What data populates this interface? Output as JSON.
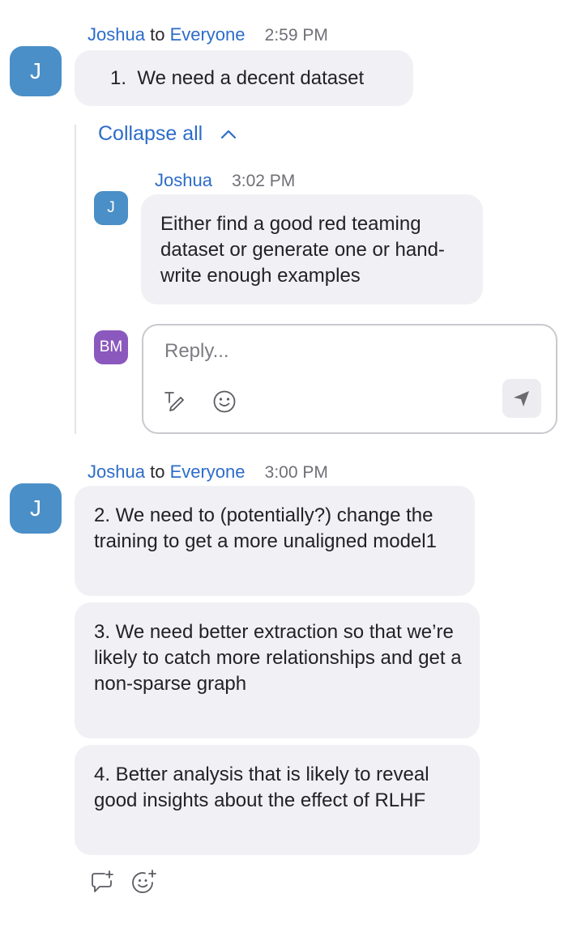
{
  "messages": [
    {
      "sender": "Joshua",
      "to_word": "to",
      "recipient": "Everyone",
      "time": "2:59 PM",
      "avatar": "J",
      "bubbles": [
        "1.  We need a decent dataset"
      ]
    },
    {
      "sender": "Joshua",
      "to_word": "to",
      "recipient": "Everyone",
      "time": "3:00 PM",
      "avatar": "J",
      "bubbles": [
        "2.  We need to (potentially?) change the training to get a more unaligned model1",
        "3.  We need better extraction so that we’re likely to catch more relationships and get a non-sparse graph",
        "4. Better analysis that is likely to reveal good insights about the effect of RLHF"
      ]
    }
  ],
  "thread": {
    "collapse_label": "Collapse all",
    "reply": {
      "sender": "Joshua",
      "time": "3:02 PM",
      "avatar": "J",
      "text": "Either find a good red teaming dataset or generate one or hand-write enough examples"
    },
    "composer": {
      "avatar": "BM",
      "placeholder": "Reply..."
    }
  },
  "icons": {
    "collapse": "chevron-up-icon",
    "format": "text-format-icon",
    "emoji": "emoji-icon",
    "send": "send-icon",
    "reply_thread": "reply-thread-icon",
    "add_reaction": "add-reaction-icon"
  },
  "colors": {
    "accent": "#2d6cc8",
    "avatar_j": "#4a8fc7",
    "avatar_bm": "#8b58bd",
    "bubble": "#f1f1f5"
  }
}
